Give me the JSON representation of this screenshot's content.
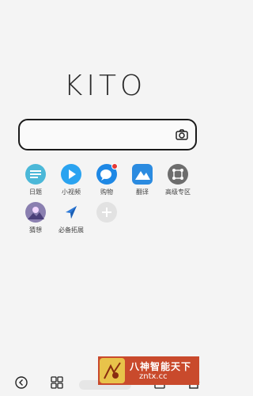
{
  "brand": {
    "logo_text": "KITO"
  },
  "search": {
    "value": "",
    "placeholder": "",
    "camera_icon": "camera-icon"
  },
  "apps": [
    {
      "label": "日题",
      "icon": "menu-lines-icon",
      "color": "#4bb8d8"
    },
    {
      "label": "小视频",
      "icon": "play-icon",
      "color": "#2aa3f0"
    },
    {
      "label": "购物",
      "icon": "chat-icon",
      "color": "#1e88e5",
      "badge": true
    },
    {
      "label": "翻译",
      "icon": "mountain-icon",
      "color": "#2b8be0"
    },
    {
      "label": "高级专区",
      "icon": "nodes-icon",
      "color": "#6d6d6d"
    },
    {
      "label": "猜想",
      "icon": "landscape-icon",
      "color": "#8a7fb0"
    },
    {
      "label": "必备拓展",
      "icon": "arrow-shape-icon",
      "color": "#2e7ad8"
    },
    {
      "label": "",
      "icon": "plus-icon",
      "color": "#e2e2e2"
    }
  ],
  "bottombar": {
    "icons": [
      "back-icon",
      "tabs-grid-icon",
      "menu-icon",
      "share-icon",
      "home-icon"
    ]
  },
  "watermark": {
    "title": "八神智能天下",
    "url": "zntx.cc"
  },
  "colors": {
    "accent": "#2196f3",
    "badge": "#e53935",
    "watermark_bg": "#c94a2c"
  }
}
